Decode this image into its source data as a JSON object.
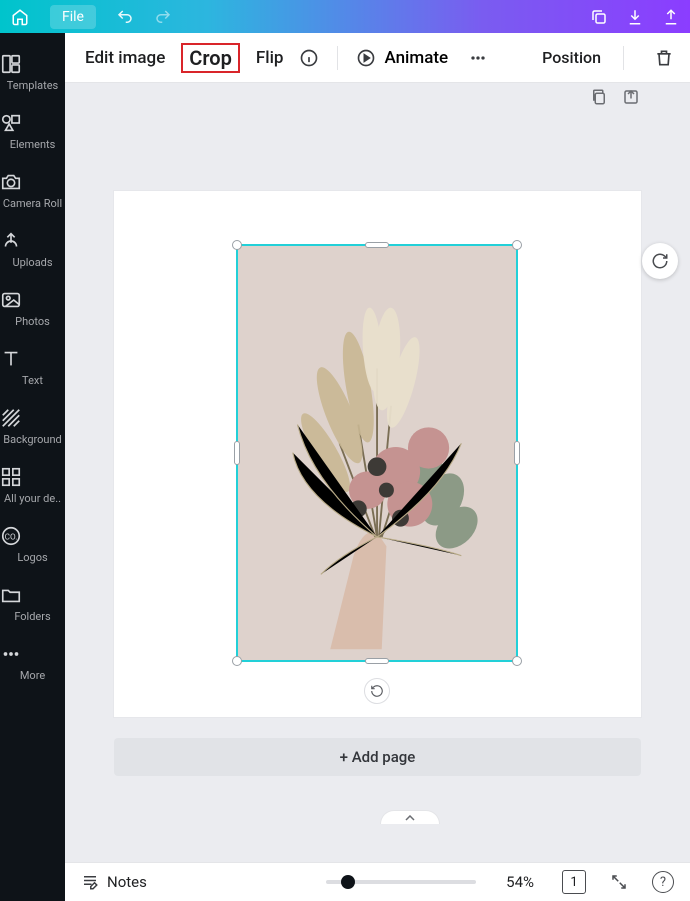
{
  "top": {
    "file_label": "File"
  },
  "sidebar": {
    "items": [
      {
        "label": "Templates"
      },
      {
        "label": "Elements"
      },
      {
        "label": "Camera Roll"
      },
      {
        "label": "Uploads"
      },
      {
        "label": "Photos"
      },
      {
        "label": "Text"
      },
      {
        "label": "Background"
      },
      {
        "label": "All your de.."
      },
      {
        "label": "Logos"
      },
      {
        "label": "Folders"
      },
      {
        "label": "More"
      }
    ]
  },
  "context": {
    "edit_image": "Edit image",
    "crop": "Crop",
    "flip": "Flip",
    "animate": "Animate",
    "position": "Position"
  },
  "canvas": {
    "add_page": "+ Add page"
  },
  "bottom": {
    "notes": "Notes",
    "zoom": "54%",
    "page": "1",
    "slider_percent": 10
  },
  "colors": {
    "selection": "#22d0d8",
    "highlight_border": "#d9252a"
  }
}
